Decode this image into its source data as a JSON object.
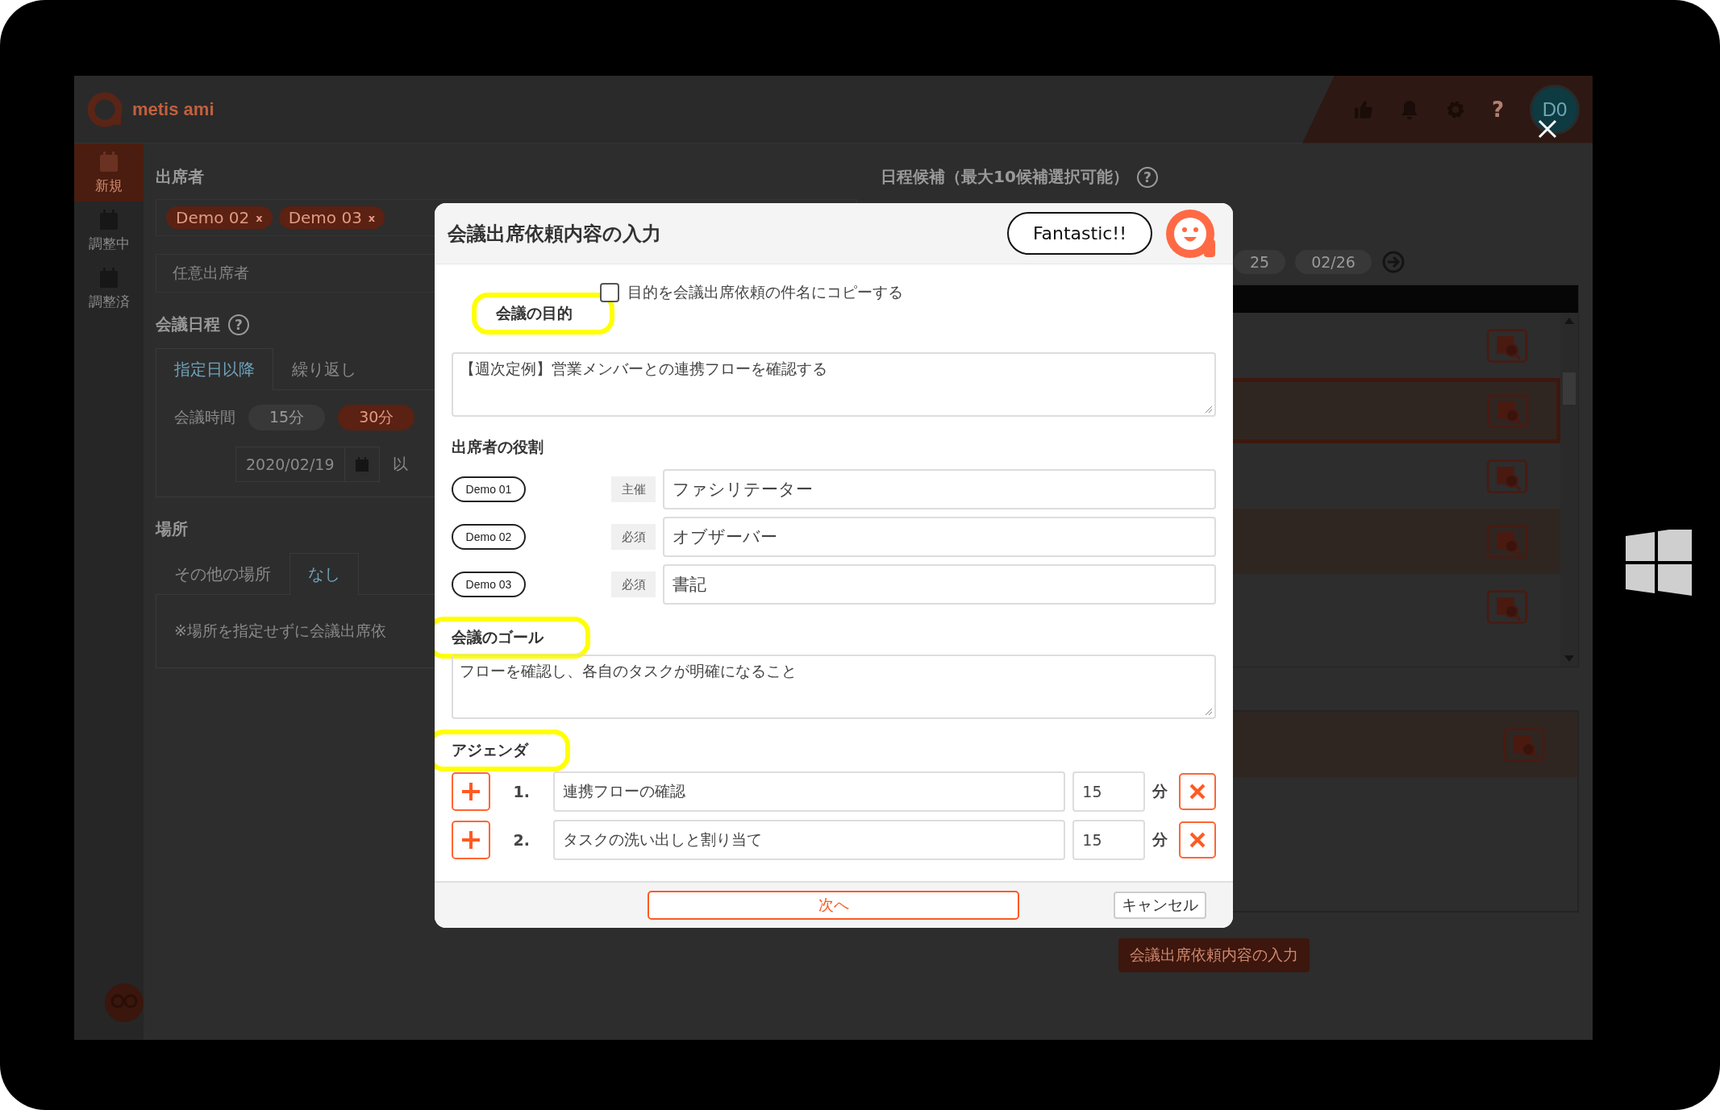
{
  "app": {
    "logo": "metis ami",
    "help": "?",
    "avatar": "D0"
  },
  "sidebar": [
    {
      "label": "新規",
      "selected": true
    },
    {
      "label": "調整中",
      "selected": false
    },
    {
      "label": "調整済",
      "selected": false
    }
  ],
  "attendees": {
    "title": "出席者",
    "chips": [
      {
        "label": "Demo 02",
        "remove": "x"
      },
      {
        "label": "Demo 03",
        "remove": "x"
      }
    ],
    "optional_placeholder": "任意出席者"
  },
  "schedule": {
    "title": "会議日程",
    "help": "?",
    "tabs": [
      {
        "label": "指定日以降",
        "selected": true
      },
      {
        "label": "繰り返し",
        "selected": false
      }
    ],
    "duration_label": "会議時間",
    "durations": [
      {
        "label": "15分",
        "selected": false
      },
      {
        "label": "30分",
        "selected": true
      }
    ],
    "date": "2020/02/19",
    "date_suffix": "以"
  },
  "place": {
    "title": "場所",
    "tabs": [
      {
        "label": "その他の場所",
        "selected": false
      },
      {
        "label": "なし",
        "selected": true
      }
    ],
    "note": "※場所を指定せずに会議出席依"
  },
  "candidates": {
    "title": "日程候補（最大10候補選択可能）",
    "help": "?",
    "dates": [
      {
        "label": "25"
      },
      {
        "label": "02/26"
      }
    ],
    "rows": [
      {
        "selected": false
      },
      {
        "selected": true
      },
      {
        "selected": false
      },
      {
        "selected": false
      },
      {
        "selected": false
      }
    ],
    "chosen_rows": [
      {
        "selected": false
      }
    ]
  },
  "submit_button": "会議出席依頼内容の入力",
  "modal": {
    "title": "会議出席依頼内容の入力",
    "bubble": "Fantastic!!",
    "copy_option": {
      "label": "目的を会議出席依頼の件名にコピーする",
      "checked": false
    },
    "purpose": {
      "label": "会議の目的",
      "highlighted": true,
      "value": "【週次定例】営業メンバーとの連携フローを確認する"
    },
    "roles": {
      "label": "出席者の役割",
      "highlighted": false,
      "rows": [
        {
          "name": "Demo 01",
          "role": "主催",
          "value": "ファシリテーター"
        },
        {
          "name": "Demo 02",
          "role": "必須",
          "value": "オブザーバー"
        },
        {
          "name": "Demo 03",
          "role": "必須",
          "value": "書記"
        }
      ]
    },
    "goal": {
      "label": "会議のゴール",
      "highlighted": true,
      "value": "フローを確認し、各自のタスクが明確になること"
    },
    "agenda": {
      "label": "アジェンダ",
      "highlighted": true,
      "rows": [
        {
          "number": "1.",
          "title": "連携フローの確認",
          "minutes": "15",
          "unit": "分"
        },
        {
          "number": "2.",
          "title": "タスクの洗い出しと割り当て",
          "minutes": "15",
          "unit": "分"
        }
      ]
    },
    "next_button": "次へ",
    "cancel_button": "キャンセル"
  }
}
